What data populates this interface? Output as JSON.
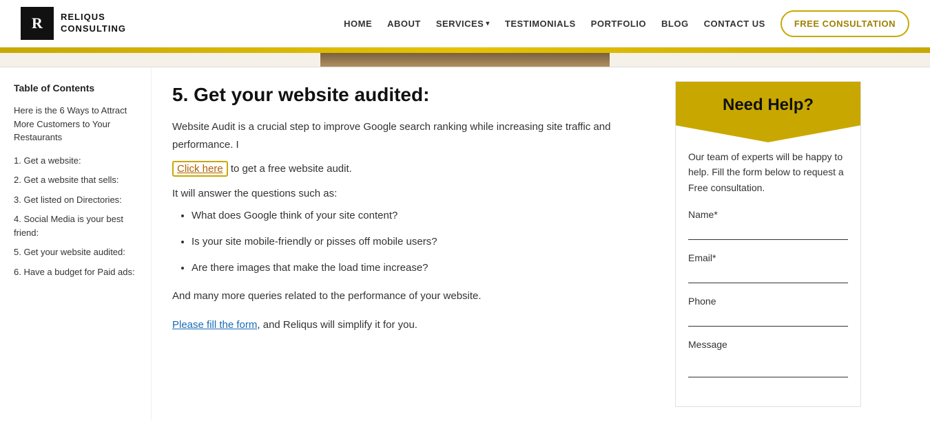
{
  "header": {
    "logo_letter": "R",
    "logo_name": "Reliqus\nConsulting",
    "nav": {
      "items": [
        {
          "label": "HOME",
          "id": "home"
        },
        {
          "label": "ABOUT",
          "id": "about"
        },
        {
          "label": "SERVICES",
          "id": "services",
          "has_dropdown": true
        },
        {
          "label": "TESTIMONIALS",
          "id": "testimonials"
        },
        {
          "label": "PORTFOLIO",
          "id": "portfolio"
        },
        {
          "label": "BLOG",
          "id": "blog"
        },
        {
          "label": "CONTACT US",
          "id": "contact"
        }
      ],
      "cta_label": "FREE CONSULTATION"
    }
  },
  "sidebar": {
    "toc_title": "Table of Contents",
    "toc_intro": "Here is the 6 Ways to Attract More Customers to Your Restaurants",
    "toc_items": [
      "1. Get a website:",
      "2. Get a website that sells:",
      "3. Get listed on Directories:",
      "4. Social Media is your best friend:",
      "5. Get your website audited:",
      "6. Have a budget for Paid ads:"
    ]
  },
  "content": {
    "section_number": "5.",
    "section_title": "Get your website audited:",
    "paragraph1": "Website Audit is a crucial step to improve Google search ranking while increasing site traffic and performance. I",
    "click_here_text": "Click here",
    "after_click_here": " to get a free website audit.",
    "it_will": "It will answer the questions such as:",
    "bullets": [
      "What does Google think of your site content?",
      "Is your site mobile-friendly or pisses off mobile users?",
      "Are there images that make the load time increase?"
    ],
    "paragraph2": "And many more queries related to the performance of your website.",
    "paragraph3_before": "",
    "paragraph3_please": "Please fill the form",
    "paragraph3_after": ", and Reliqus will simplify it for you."
  },
  "right_panel": {
    "header": "Need Help?",
    "description": "Our team of experts will be happy to help. Fill the form below to request a Free consultation.",
    "form": {
      "name_label": "Name*",
      "email_label": "Email*",
      "phone_label": "Phone",
      "message_label": "Message",
      "name_placeholder": "",
      "email_placeholder": "",
      "phone_placeholder": "",
      "message_placeholder": ""
    }
  }
}
